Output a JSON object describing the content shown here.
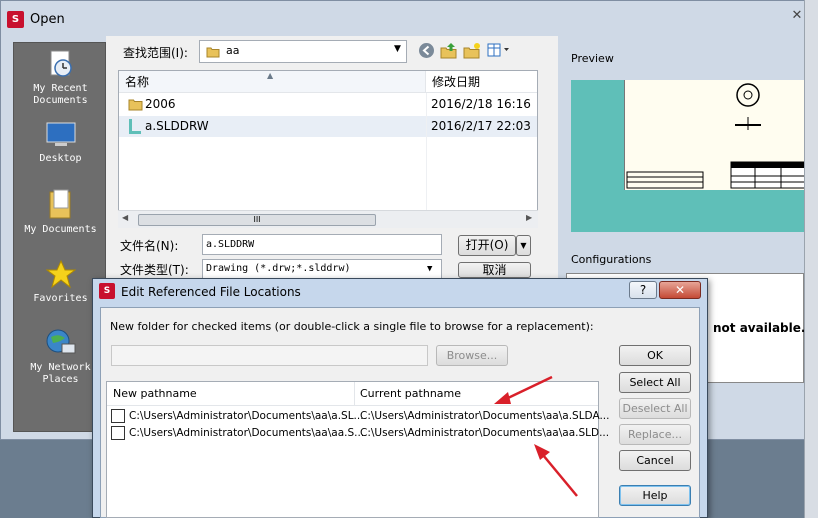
{
  "open_dialog": {
    "title": "Open",
    "close_symbol": "✕",
    "places": [
      {
        "label": "My Recent\nDocuments",
        "icon": "recent-documents-icon"
      },
      {
        "label": "Desktop",
        "icon": "desktop-icon"
      },
      {
        "label": "My Documents",
        "icon": "my-documents-icon"
      },
      {
        "label": "Favorites",
        "icon": "favorites-star-icon"
      },
      {
        "label": "My Network\nPlaces",
        "icon": "network-places-icon"
      }
    ],
    "look_in": {
      "label": "查找范围(I):",
      "value": "aa"
    },
    "columns": {
      "name": "名称",
      "modified": "修改日期"
    },
    "files": [
      {
        "name": "2006",
        "modified": "2016/2/18 16:16",
        "icon": "folder-icon"
      },
      {
        "name": "a.SLDDRW",
        "modified": "2016/2/17 22:03",
        "icon": "drawing-file-icon"
      }
    ],
    "scroll_thumb_grip": "III",
    "file_name": {
      "label": "文件名(N):",
      "value": "a.SLDDRW"
    },
    "file_type": {
      "label": "文件类型(T):",
      "value": "Drawing (*.drw;*.slddrw)"
    },
    "open_button": "打开(O)",
    "cancel_button": "取消",
    "preview_label": "Preview",
    "configurations_label": "Configurations",
    "configurations_message": "not available."
  },
  "erfl_dialog": {
    "title": "Edit Referenced File Locations",
    "help_caption": "?",
    "close_caption": "✕",
    "instruction": "New folder for checked items (or double-click a single file to browse for a replacement):",
    "folder_value": "",
    "browse_button": "Browse...",
    "columns": {
      "new": "New pathname",
      "current": "Current pathname"
    },
    "rows": [
      {
        "new": "C:\\Users\\Administrator\\Documents\\aa\\a.SL...",
        "current": "C:\\Users\\Administrator\\Documents\\aa\\a.SLDA..."
      },
      {
        "new": "C:\\Users\\Administrator\\Documents\\aa\\aa.S...",
        "current": "C:\\Users\\Administrator\\Documents\\aa\\aa.SLD..."
      }
    ],
    "buttons": {
      "ok": "OK",
      "select_all": "Select All",
      "deselect_all": "Deselect All",
      "replace": "Replace...",
      "cancel": "Cancel",
      "help": "Help"
    }
  },
  "colors": {
    "annotation_arrow": "#d9202a",
    "preview_background": "#5fbfb8",
    "app_logo": "#c8102e"
  }
}
